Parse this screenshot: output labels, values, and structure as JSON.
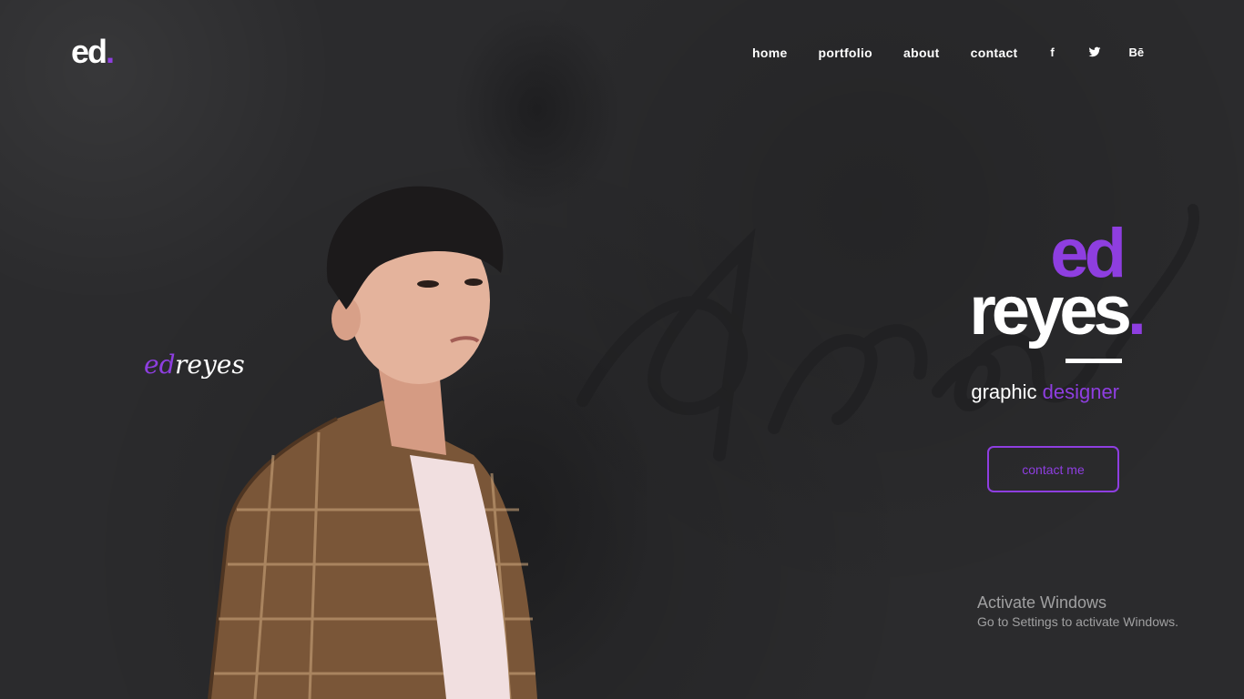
{
  "logo": {
    "text": "ed",
    "dot": "."
  },
  "nav": {
    "items": [
      {
        "label": "home"
      },
      {
        "label": "portfolio"
      },
      {
        "label": "about"
      },
      {
        "label": "contact"
      }
    ],
    "social": [
      {
        "icon": "facebook-icon",
        "label": "f"
      },
      {
        "icon": "twitter-icon",
        "label": ""
      },
      {
        "icon": "behance-icon",
        "label": "Bē"
      }
    ]
  },
  "signature": {
    "first": "ed",
    "last": "reyes"
  },
  "hero": {
    "first_name": "ed",
    "last_name": "reyes",
    "dot": ".",
    "role_part1": "graphic",
    "role_part2": "designer",
    "cta": "contact me"
  },
  "windows_notice": {
    "title": "Activate Windows",
    "subtitle": "Go to Settings to activate Windows."
  },
  "colors": {
    "background": "#2b2b2d",
    "accent": "#8e3ee0",
    "text": "#ffffff"
  }
}
